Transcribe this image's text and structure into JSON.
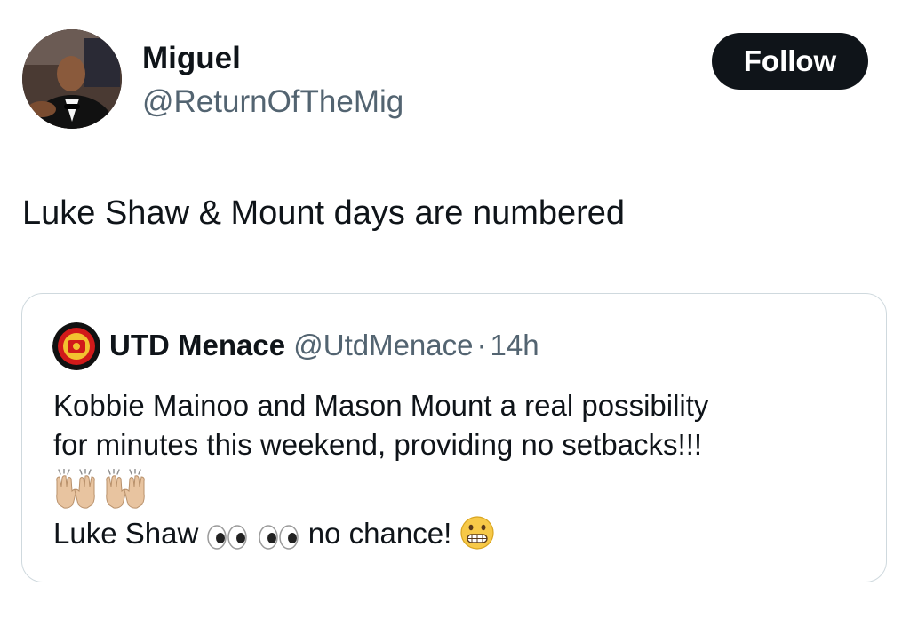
{
  "author": {
    "display_name": "Miguel",
    "handle": "@ReturnOfTheMig"
  },
  "follow_button": {
    "label": "Follow"
  },
  "tweet": {
    "text": "Luke Shaw & Mount days are numbered"
  },
  "quoted_tweet": {
    "display_name": "UTD Menace",
    "handle": "@UtdMenace",
    "separator": "·",
    "time": "14h",
    "line1": "Kobbie Mainoo and Mason Mount a real possibility",
    "line2": "for minutes this weekend, providing no setbacks!!!",
    "line3_prefix": "Luke Shaw",
    "line3_suffix": "no chance!",
    "emojis": [
      "raising-hands-icon",
      "raising-hands-icon",
      "eyes-icon",
      "eyes-icon",
      "grimacing-face-icon"
    ]
  },
  "colors": {
    "text_primary": "#0f1419",
    "text_secondary": "#536471",
    "border": "#cfd9de",
    "follow_bg": "#0f1419",
    "follow_text": "#ffffff"
  }
}
